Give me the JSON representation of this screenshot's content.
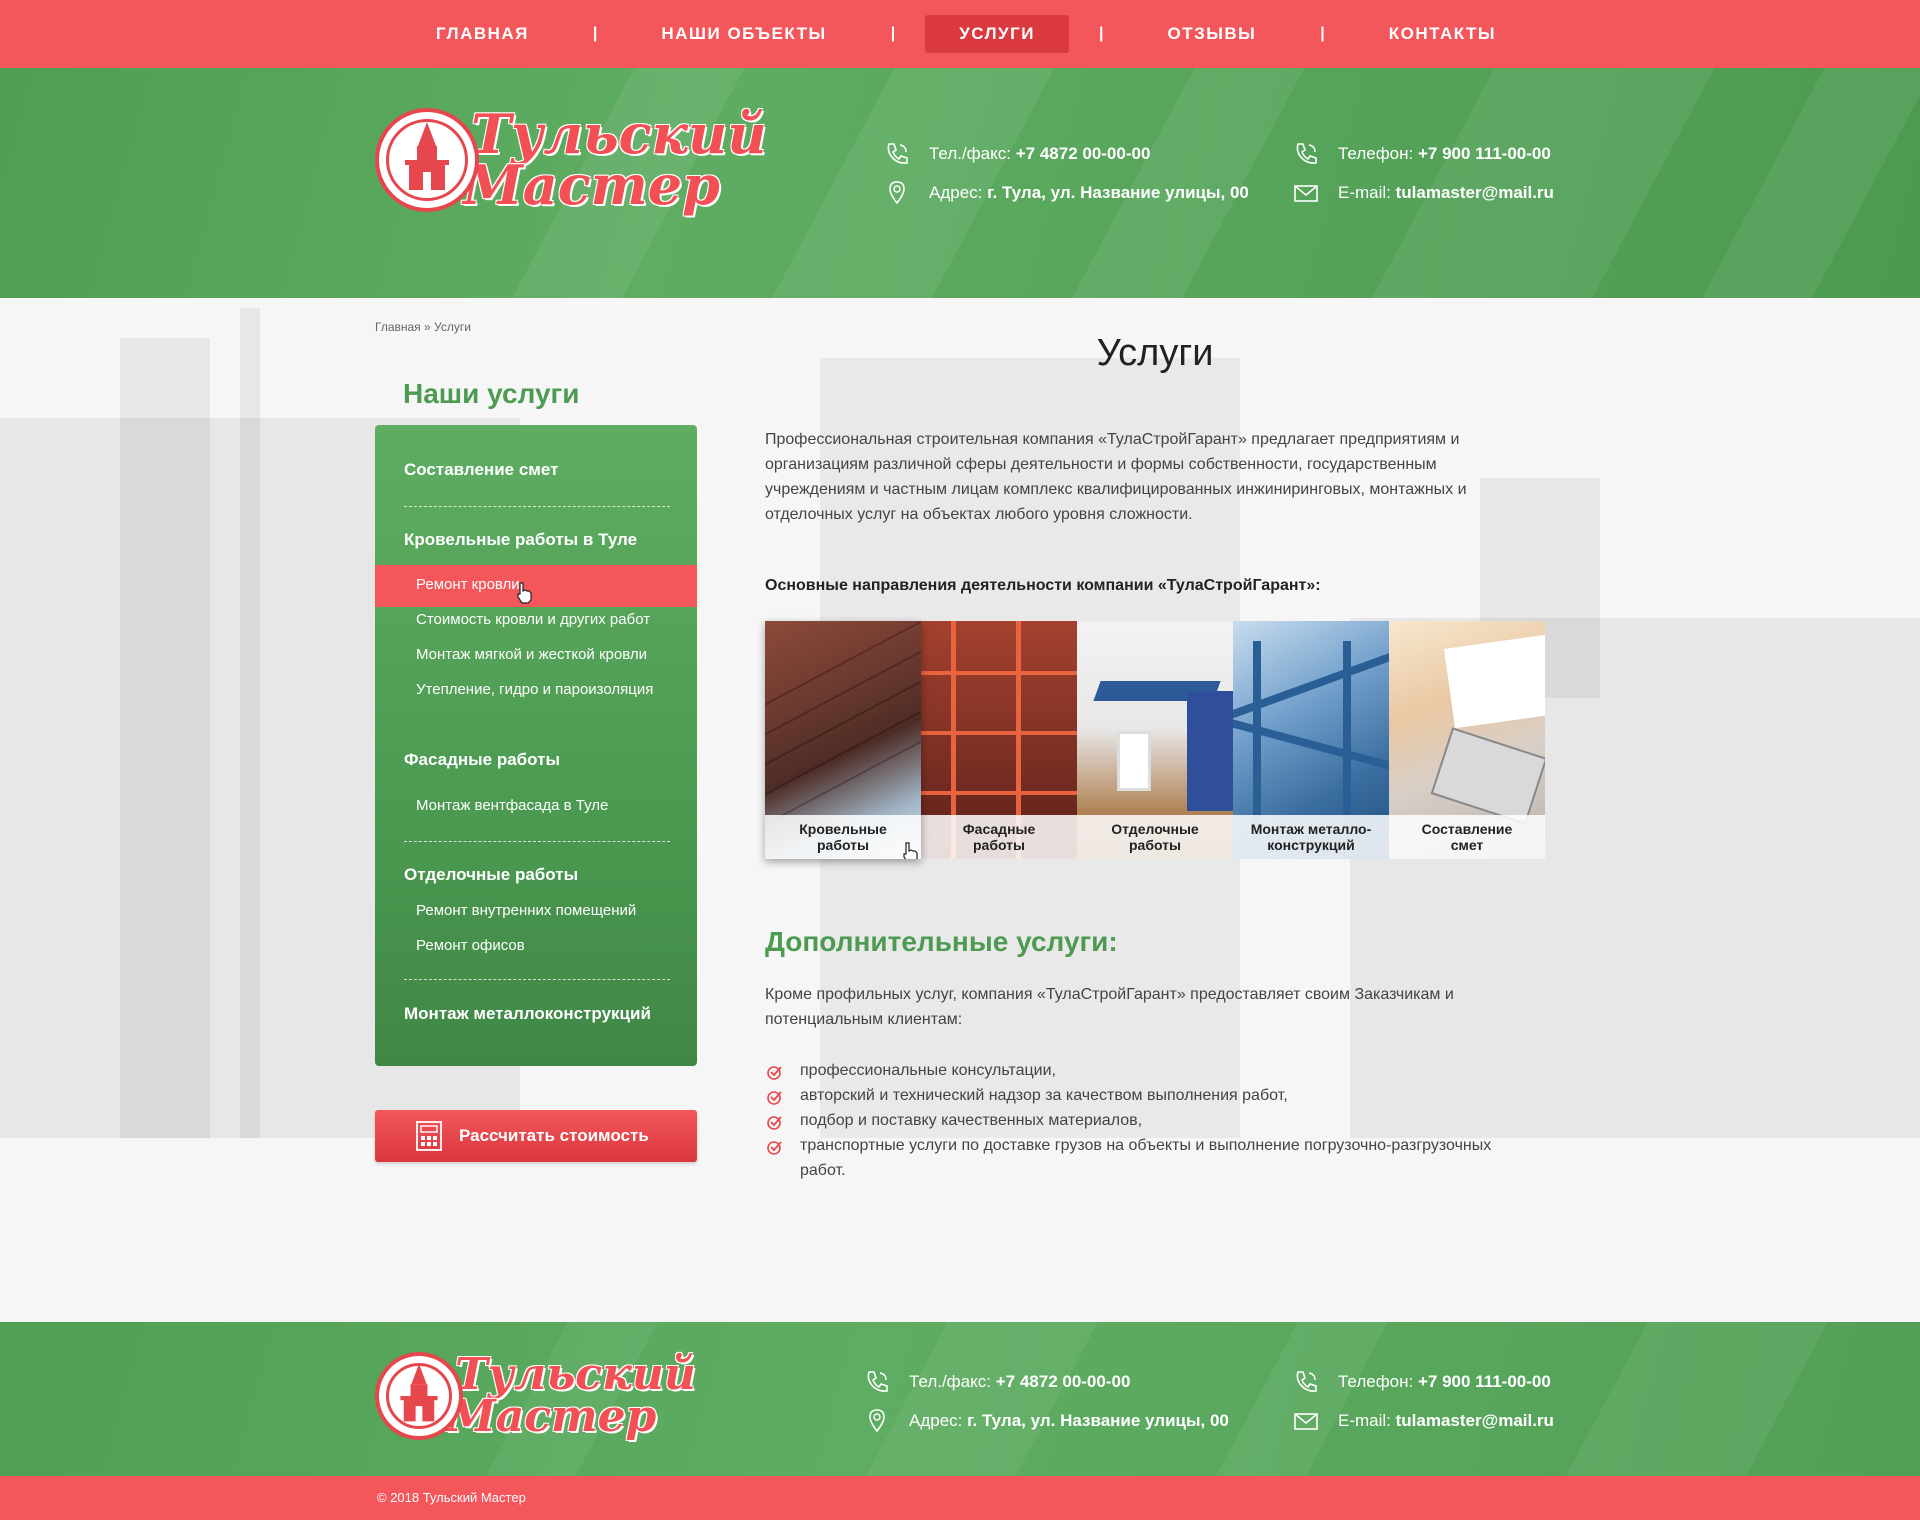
{
  "nav": {
    "items": [
      {
        "label": "Главная",
        "active": false
      },
      {
        "label": "Наши объекты",
        "active": false
      },
      {
        "label": "Услуги",
        "active": true
      },
      {
        "label": "Отзывы",
        "active": false
      },
      {
        "label": "Контакты",
        "active": false
      }
    ],
    "separator": "|"
  },
  "logo": {
    "line1": "Тульский",
    "line2": "Мастер"
  },
  "contacts": {
    "fax_label": "Тел./факс:",
    "fax_value": "+7 4872 00-00-00",
    "phone_label": "Телефон:",
    "phone_value": "+7 900 111-00-00",
    "address_label": "Адрес:",
    "address_value": "г. Тула, ул. Название улицы, 00",
    "email_label": "E-mail:",
    "email_value": "tulamaster@mail.ru"
  },
  "breadcrumb": "Главная » Услуги",
  "sidebar": {
    "title": "Наши услуги",
    "items": {
      "estimates": "Составление смет",
      "roofing": "Кровельные работы в Туле",
      "roof_repair": "Ремонт кровли",
      "roof_cost": "Стоимость кровли и других работ",
      "roof_install": "Монтаж мягкой и жесткой кровли",
      "roof_insulation": "Утепление, гидро и пароизоляция",
      "facade": "Фасадные работы",
      "facade_vent": "Монтаж вентфасада в Туле",
      "finishing": "Отделочные работы",
      "interior": "Ремонт внутренних помещений",
      "offices": "Ремонт офисов",
      "metal": "Монтаж металлоконструкций"
    }
  },
  "calc_button": "Рассчитать стоимость",
  "content": {
    "title": "Услуги",
    "intro": "Профессиональная строительная компания «ТулаСтройГарант» предлагает предприятиям и организациям различной сферы деятельности и формы собственности, государственным учреждениям и частным лицам комплекс квалифицированных инжиниринговых, монтажных и отделочных услуг на объектах любого уровня сложности.",
    "directions_title": "Основные направления деятельности компании «ТулаСтройГарант»:",
    "tiles": [
      {
        "line1": "Кровельные",
        "line2": "работы"
      },
      {
        "line1": "Фасадные",
        "line2": "работы"
      },
      {
        "line1": "Отделочные",
        "line2": "работы"
      },
      {
        "line1": "Монтаж металло-",
        "line2": "конструкций"
      },
      {
        "line1": "Составление",
        "line2": "смет"
      }
    ],
    "additional_title": "Дополнительные услуги:",
    "additional_text": "Кроме профильных услуг, компания «ТулаСтройГарант» предоставляет своим Заказчикам и потенциальным клиентам:",
    "additional_list": [
      "профессиональные консультации,",
      "авторский и технический надзор за качеством выполнения работ,",
      "подбор и поставку качественных материалов,",
      "транспортные услуги по доставке грузов на объекты и выполнение погрузочно-разгрузочных работ."
    ]
  },
  "footer": {
    "copyright": "© 2018  Тульский Мастер"
  },
  "colors": {
    "red": "#f4575b",
    "green": "#5ead62",
    "dark_green": "#4d9b52"
  }
}
